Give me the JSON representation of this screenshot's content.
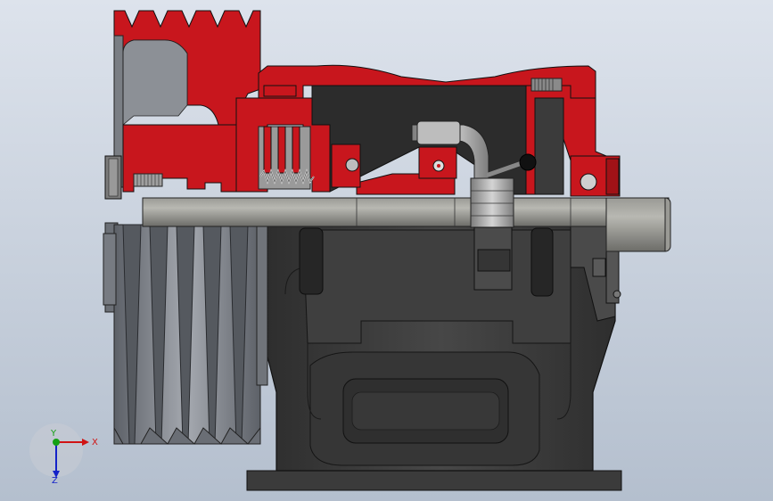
{
  "viewport": {
    "background_top": "#dde3ec",
    "background_bottom": "#b4bfce"
  },
  "colors": {
    "section_red": "#c8161d",
    "section_red_dark": "#8e0f14",
    "housing_dark": "#3a3a3a",
    "housing_mid": "#4a4a4a",
    "housing_light": "#5c5c5c",
    "edge": "#111111",
    "shaft": "#8a8a86",
    "shaft_light": "#b0b0aa",
    "pulley": "#7b7f86",
    "pulley_light": "#a4a8ae",
    "pulley_dark": "#55595f",
    "metal_light": "#c9c9c9"
  },
  "triad": {
    "x_label": "X",
    "y_label": "Y",
    "z_label": "Z",
    "x_color": "#d01414",
    "y_color": "#14a014",
    "z_color": "#1422c8"
  }
}
